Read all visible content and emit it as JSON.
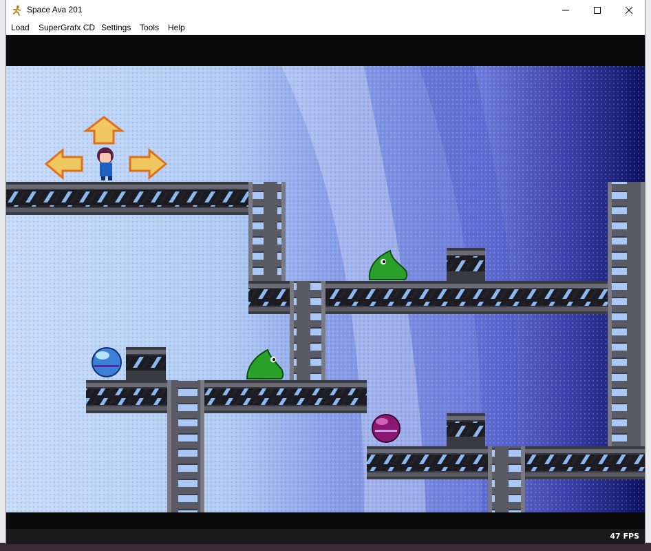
{
  "window": {
    "title": "Space Ava 201",
    "app_icon": "running-figure-icon",
    "controls": [
      "minimize-icon",
      "maximize-icon",
      "close-icon"
    ]
  },
  "menu": {
    "items": [
      {
        "label": "Load"
      },
      {
        "label": "SuperGrafx CD"
      },
      {
        "label": "Settings"
      },
      {
        "label": "Tools"
      },
      {
        "label": "Help"
      }
    ]
  },
  "game": {
    "sprites": [
      "player-character",
      "direction-arrow-up",
      "direction-arrow-left",
      "direction-arrow-right",
      "green-slime-enemy",
      "blue-orb",
      "purple-orb"
    ]
  },
  "status": {
    "fps": "47 FPS"
  },
  "colors": {
    "sky_light": "#b8d4f8",
    "sky_mid": "#7890e0",
    "sky_dark": "#101870",
    "girder": "#3a3a42",
    "girder_hatch": "#88b8f0",
    "slime": "#2aa02a",
    "arrow": "#f0a030"
  }
}
